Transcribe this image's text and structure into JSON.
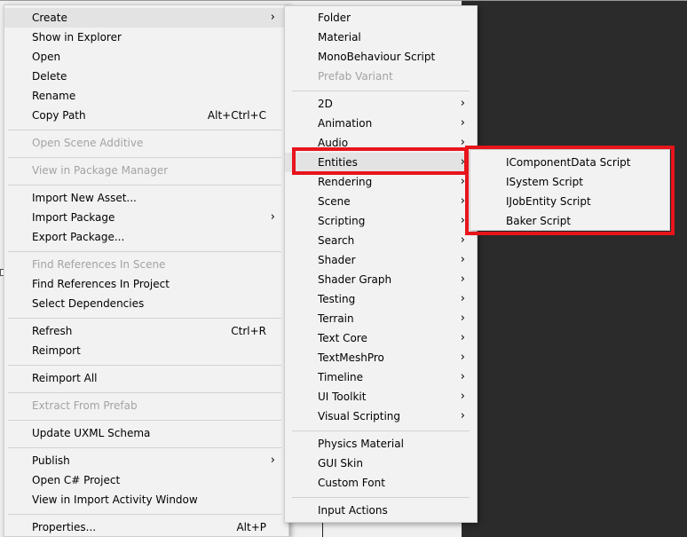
{
  "main_menu": {
    "items": [
      {
        "label": "Create",
        "submenu": true,
        "highlighted": true
      },
      {
        "label": "Show in Explorer"
      },
      {
        "label": "Open"
      },
      {
        "label": "Delete"
      },
      {
        "label": "Rename"
      },
      {
        "label": "Copy Path",
        "shortcut": "Alt+Ctrl+C"
      },
      {
        "label": "Open Scene Additive",
        "disabled": true
      },
      {
        "label": "View in Package Manager",
        "disabled": true
      },
      {
        "label": "Import New Asset..."
      },
      {
        "label": "Import Package",
        "submenu": true
      },
      {
        "label": "Export Package..."
      },
      {
        "label": "Find References In Scene",
        "disabled": true
      },
      {
        "label": "Find References In Project"
      },
      {
        "label": "Select Dependencies"
      },
      {
        "label": "Refresh",
        "shortcut": "Ctrl+R"
      },
      {
        "label": "Reimport"
      },
      {
        "label": "Reimport All"
      },
      {
        "label": "Extract From Prefab",
        "disabled": true
      },
      {
        "label": "Update UXML Schema"
      },
      {
        "label": "Publish",
        "submenu": true
      },
      {
        "label": "Open C# Project"
      },
      {
        "label": "View in Import Activity Window"
      },
      {
        "label": "Properties...",
        "shortcut": "Alt+P"
      }
    ]
  },
  "create_menu": {
    "items": [
      {
        "label": "Folder"
      },
      {
        "label": "Material"
      },
      {
        "label": "MonoBehaviour Script"
      },
      {
        "label": "Prefab Variant",
        "disabled": true
      },
      {
        "label": "2D",
        "submenu": true
      },
      {
        "label": "Animation",
        "submenu": true
      },
      {
        "label": "Audio",
        "submenu": true
      },
      {
        "label": "Entities",
        "submenu": true,
        "highlighted": true
      },
      {
        "label": "Rendering",
        "submenu": true
      },
      {
        "label": "Scene",
        "submenu": true
      },
      {
        "label": "Scripting",
        "submenu": true
      },
      {
        "label": "Search",
        "submenu": true
      },
      {
        "label": "Shader",
        "submenu": true
      },
      {
        "label": "Shader Graph",
        "submenu": true
      },
      {
        "label": "Testing",
        "submenu": true
      },
      {
        "label": "Terrain",
        "submenu": true
      },
      {
        "label": "Text Core",
        "submenu": true
      },
      {
        "label": "TextMeshPro",
        "submenu": true
      },
      {
        "label": "Timeline",
        "submenu": true
      },
      {
        "label": "UI Toolkit",
        "submenu": true
      },
      {
        "label": "Visual Scripting",
        "submenu": true
      },
      {
        "label": "Physics Material"
      },
      {
        "label": "GUI Skin"
      },
      {
        "label": "Custom Font"
      },
      {
        "label": "Input Actions"
      }
    ]
  },
  "entities_menu": {
    "items": [
      {
        "label": "IComponentData Script"
      },
      {
        "label": "ISystem Script"
      },
      {
        "label": "IJobEntity Script"
      },
      {
        "label": "Baker Script"
      }
    ]
  },
  "arrow_glyph": "›",
  "colors": {
    "menu_bg": "#f2f2f2",
    "highlight": "#e3e3e3",
    "disabled_text": "#a3a3a3",
    "annotation_red": "#e8141c",
    "editor_dark": "#383838"
  }
}
